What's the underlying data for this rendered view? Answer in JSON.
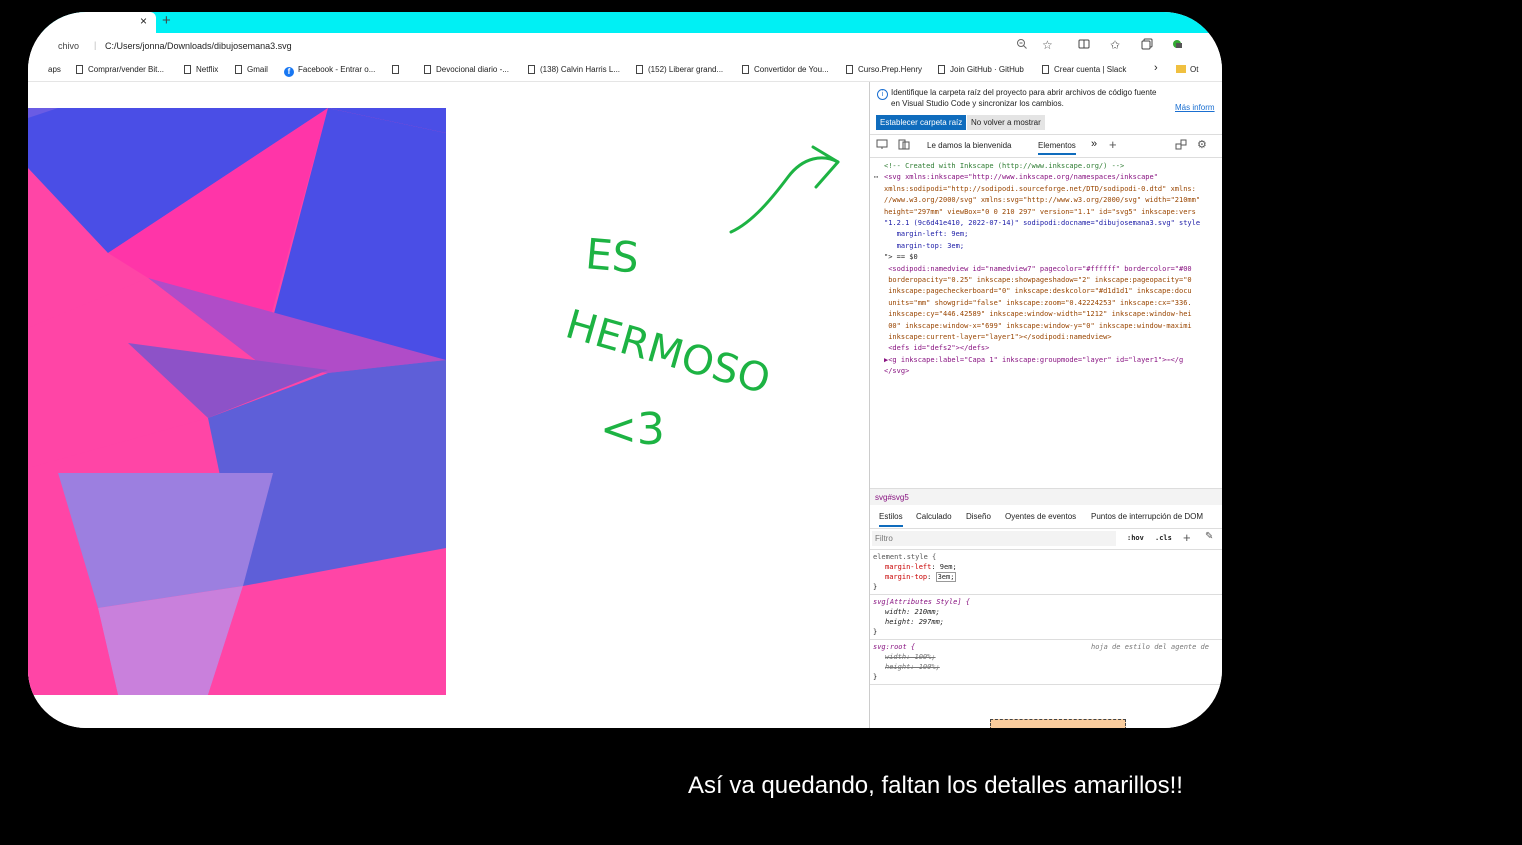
{
  "browser": {
    "tab_close": "×",
    "new_tab": "+",
    "address_prefix": "chivo",
    "address_url": "C:/Users/jonna/Downloads/dibujosemana3.svg",
    "toolbar_icons": [
      "zoom-icon",
      "favorite-star-icon",
      "split-screen-icon",
      "favorites-icon",
      "collections-icon",
      "extension-icon"
    ]
  },
  "bookmarks": [
    {
      "label": "aps",
      "icon": "none"
    },
    {
      "label": "Comprar/vender Bit...",
      "icon": "doc"
    },
    {
      "label": "Netflix",
      "icon": "doc"
    },
    {
      "label": "Gmail",
      "icon": "doc"
    },
    {
      "label": "Facebook - Entrar o...",
      "icon": "facebook"
    },
    {
      "label": "",
      "icon": "doc"
    },
    {
      "label": "Devocional diario -...",
      "icon": "doc"
    },
    {
      "label": "(138) Calvin Harris L...",
      "icon": "doc"
    },
    {
      "label": "(152) Liberar grand...",
      "icon": "doc"
    },
    {
      "label": "Convertidor de You...",
      "icon": "doc"
    },
    {
      "label": "Curso.Prep.Henry",
      "icon": "doc"
    },
    {
      "label": "Join GitHub · GitHub",
      "icon": "doc"
    },
    {
      "label": "Crear cuenta | Slack",
      "icon": "doc"
    },
    {
      "label": "›",
      "icon": "none"
    },
    {
      "label": "Ot",
      "icon": "folder"
    }
  ],
  "handwriting": {
    "line1": "ES",
    "line2": "HERMOSO",
    "line3": "<3",
    "color": "#1db343"
  },
  "art_colors": {
    "pink": "#ff45a6",
    "blue": "#4a4ee6",
    "lavender": "#9c7fe0",
    "purple": "#5c5bd6"
  },
  "devtools": {
    "info_line1": "Identifique la carpeta raíz del proyecto para abrir archivos de código fuente",
    "info_line2": "en Visual Studio Code y sincronizar los cambios.",
    "info_more": "Más inform",
    "btn_setroot": "Establecer carpeta raíz",
    "btn_dismiss": "No volver a mostrar",
    "tabs": {
      "welcome": "Le damos la bienvenida",
      "elements": "Elementos",
      "more": "»",
      "add": "+"
    },
    "dom": [
      {
        "t": "<!-- Created with Inkscape (http://www.inkscape.org/) -->",
        "c": "cm"
      },
      {
        "t": "<svg xmlns:inkscape=\"http://www.inkscape.org/namespaces/inkscape\"",
        "c": "tg"
      },
      {
        "t": "xmlns:sodipodi=\"http://sodipodi.sourceforge.net/DTD/sodipodi-0.dtd\" xmlns:",
        "c": "at"
      },
      {
        "t": "//www.w3.org/2000/svg\" xmlns:svg=\"http://www.w3.org/2000/svg\" width=\"210mm\"",
        "c": "at"
      },
      {
        "t": "height=\"297mm\" viewBox=\"0 0 210 297\" version=\"1.1\" id=\"svg5\" inkscape:vers",
        "c": "at"
      },
      {
        "t": "\"1.2.1 (9c6d41e410, 2022-07-14)\" sodipodi:docname=\"dibujosemana3.svg\" style",
        "c": "av"
      },
      {
        "t": "   margin-left: 9em;",
        "c": "av"
      },
      {
        "t": "   margin-top: 3em;",
        "c": "av"
      },
      {
        "t": "\"> == $0",
        "c": "pl"
      },
      {
        "t": " <sodipodi:namedview id=\"namedview7\" pagecolor=\"#ffffff\" bordercolor=\"#00",
        "c": "tg"
      },
      {
        "t": " borderopacity=\"0.25\" inkscape:showpageshadow=\"2\" inkscape:pageopacity=\"0",
        "c": "at"
      },
      {
        "t": " inkscape:pagecheckerboard=\"0\" inkscape:deskcolor=\"#d1d1d1\" inkscape:docu",
        "c": "at"
      },
      {
        "t": " units=\"mm\" showgrid=\"false\" inkscape:zoom=\"0.42224253\" inkscape:cx=\"336.",
        "c": "at"
      },
      {
        "t": " inkscape:cy=\"446.42589\" inkscape:window-width=\"1212\" inkscape:window-hei",
        "c": "at"
      },
      {
        "t": " 00\" inkscape:window-x=\"699\" inkscape:window-y=\"0\" inkscape:window-maximi",
        "c": "at"
      },
      {
        "t": " inkscape:current-layer=\"layer1\"></sodipodi:namedview>",
        "c": "at"
      },
      {
        "t": " <defs id=\"defs2\"></defs>",
        "c": "tg"
      },
      {
        "t": "▶<g inkscape:label=\"Capa 1\" inkscape:groupmode=\"layer\" id=\"layer1\">⋯</g",
        "c": "tg"
      },
      {
        "t": "</svg>",
        "c": "tg"
      }
    ],
    "breadcrumb": "svg#svg5",
    "styles_tabs": [
      "Estilos",
      "Calculado",
      "Diseño",
      "Oyentes de eventos",
      "Puntos de interrupción de DOM"
    ],
    "filter_placeholder": "Filtro",
    "filter_hov": ":hov",
    "filter_cls": ".cls",
    "rules": {
      "r1_selector": "element.style {",
      "r1_d1_name": "margin-left",
      "r1_d1_value": "9em;",
      "r1_d2_name": "margin-top",
      "r1_d2_value": "3em;",
      "r2_selector": "svg[Attributes Style] {",
      "r2_d1": "width: 210mm;",
      "r2_d2": "height: 297mm;",
      "r3_selector": "svg:root {",
      "r3_source": "hoja de estilo del agente de",
      "r3_d1": "width: 100%;",
      "r3_d2": "height: 100%;",
      "close": "}"
    }
  },
  "caption": "Así va quedando, faltan los detalles amarillos!!"
}
